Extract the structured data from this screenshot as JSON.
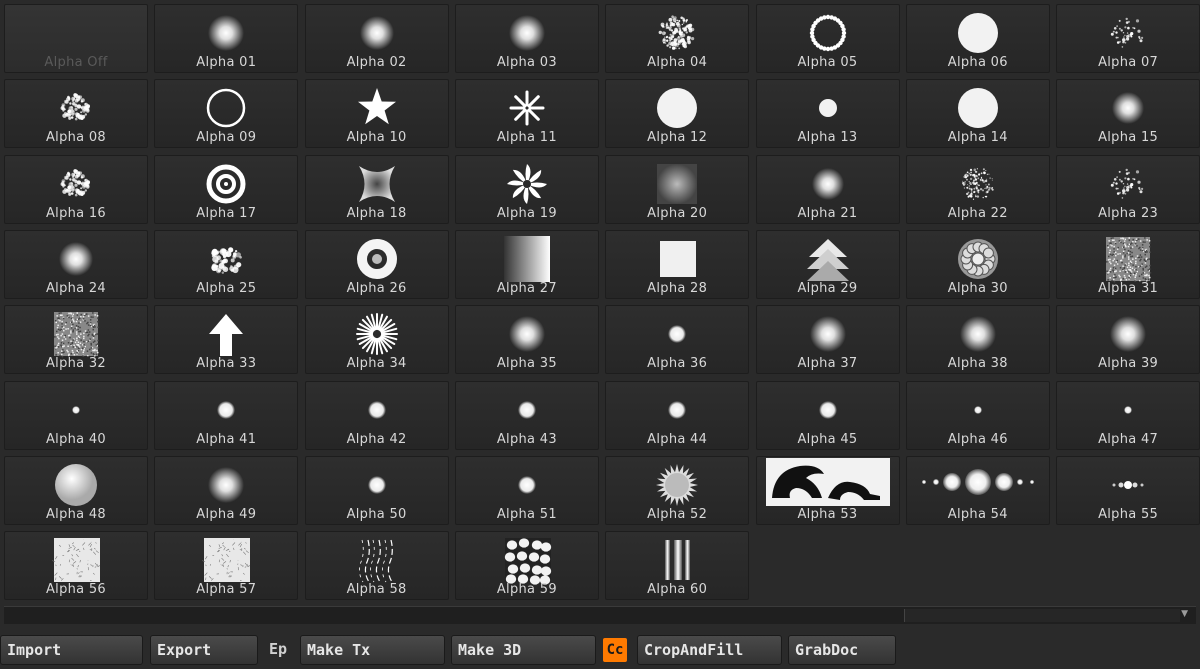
{
  "alpha_palette": {
    "off_label": "Alpha Off",
    "items": [
      {
        "label": "Alpha 01",
        "icon": "soft-round-brush"
      },
      {
        "label": "Alpha 02",
        "icon": "fuzzy-round-brush"
      },
      {
        "label": "Alpha 03",
        "icon": "soft-round-brush"
      },
      {
        "label": "Alpha 04",
        "icon": "noise-round-brush"
      },
      {
        "label": "Alpha 05",
        "icon": "dotted-ring"
      },
      {
        "label": "Alpha 06",
        "icon": "solid-circle"
      },
      {
        "label": "Alpha 07",
        "icon": "speckle-dots"
      },
      {
        "label": "Alpha 08",
        "icon": "speckle-splat"
      },
      {
        "label": "Alpha 09",
        "icon": "ring-outline"
      },
      {
        "label": "Alpha 10",
        "icon": "star"
      },
      {
        "label": "Alpha 11",
        "icon": "starburst"
      },
      {
        "label": "Alpha 12",
        "icon": "solid-circle"
      },
      {
        "label": "Alpha 13",
        "icon": "small-circle"
      },
      {
        "label": "Alpha 14",
        "icon": "solid-circle"
      },
      {
        "label": "Alpha 15",
        "icon": "fuzzy-splat"
      },
      {
        "label": "Alpha 16",
        "icon": "speckle-splat"
      },
      {
        "label": "Alpha 17",
        "icon": "concentric-rings"
      },
      {
        "label": "Alpha 18",
        "icon": "pinched-square"
      },
      {
        "label": "Alpha 19",
        "icon": "swirl-flower"
      },
      {
        "label": "Alpha 20",
        "icon": "soft-square"
      },
      {
        "label": "Alpha 21",
        "icon": "fuzzy-splat"
      },
      {
        "label": "Alpha 22",
        "icon": "scribble-noise"
      },
      {
        "label": "Alpha 23",
        "icon": "speckle-dots"
      },
      {
        "label": "Alpha 24",
        "icon": "fuzzy-round-brush"
      },
      {
        "label": "Alpha 25",
        "icon": "dim-cells"
      },
      {
        "label": "Alpha 26",
        "icon": "soft-ring"
      },
      {
        "label": "Alpha 27",
        "icon": "gradient-square"
      },
      {
        "label": "Alpha 28",
        "icon": "solid-square"
      },
      {
        "label": "Alpha 29",
        "icon": "stacked-arrows"
      },
      {
        "label": "Alpha 30",
        "icon": "voronoi-sphere"
      },
      {
        "label": "Alpha 31",
        "icon": "noise-square"
      },
      {
        "label": "Alpha 32",
        "icon": "noise-square"
      },
      {
        "label": "Alpha 33",
        "icon": "arrow-up"
      },
      {
        "label": "Alpha 34",
        "icon": "sunburst"
      },
      {
        "label": "Alpha 35",
        "icon": "soft-round-brush"
      },
      {
        "label": "Alpha 36",
        "icon": "small-soft-dot"
      },
      {
        "label": "Alpha 37",
        "icon": "soft-round-brush"
      },
      {
        "label": "Alpha 38",
        "icon": "soft-round-brush"
      },
      {
        "label": "Alpha 39",
        "icon": "soft-round-brush"
      },
      {
        "label": "Alpha 40",
        "icon": "tiny-dot"
      },
      {
        "label": "Alpha 41",
        "icon": "small-soft-dot"
      },
      {
        "label": "Alpha 42",
        "icon": "small-soft-dot"
      },
      {
        "label": "Alpha 43",
        "icon": "small-soft-dot"
      },
      {
        "label": "Alpha 44",
        "icon": "small-soft-dot"
      },
      {
        "label": "Alpha 45",
        "icon": "small-soft-dot"
      },
      {
        "label": "Alpha 46",
        "icon": "tiny-dot"
      },
      {
        "label": "Alpha 47",
        "icon": "tiny-dot"
      },
      {
        "label": "Alpha 48",
        "icon": "large-soft-circle"
      },
      {
        "label": "Alpha 49",
        "icon": "soft-round-brush"
      },
      {
        "label": "Alpha 50",
        "icon": "small-soft-dot"
      },
      {
        "label": "Alpha 51",
        "icon": "small-soft-dot"
      },
      {
        "label": "Alpha 52",
        "icon": "spiky-sun"
      },
      {
        "label": "Alpha 53",
        "icon": "dinosaur-stencil"
      },
      {
        "label": "Alpha 54",
        "icon": "dot-row-wide"
      },
      {
        "label": "Alpha 55",
        "icon": "dot-row-small"
      },
      {
        "label": "Alpha 56",
        "icon": "crackle-square"
      },
      {
        "label": "Alpha 57",
        "icon": "crackle-square"
      },
      {
        "label": "Alpha 58",
        "icon": "streak-lines"
      },
      {
        "label": "Alpha 59",
        "icon": "cobblestone-square"
      },
      {
        "label": "Alpha 60",
        "icon": "vertical-bars"
      }
    ]
  },
  "toolbar": {
    "import_label": "Import",
    "export_label": "Export",
    "ep_label": "Ep",
    "make_tx_label": "Make Tx",
    "make_3d_label": "Make 3D",
    "cc_label": "Cc",
    "crop_and_fill_label": "CropAndFill",
    "grab_doc_label": "GrabDoc"
  },
  "colors": {
    "background": "#2a2a2a",
    "tile": "#2b2b2b",
    "label_text": "#d8d8d8",
    "accent_orange": "#ff7a00"
  }
}
